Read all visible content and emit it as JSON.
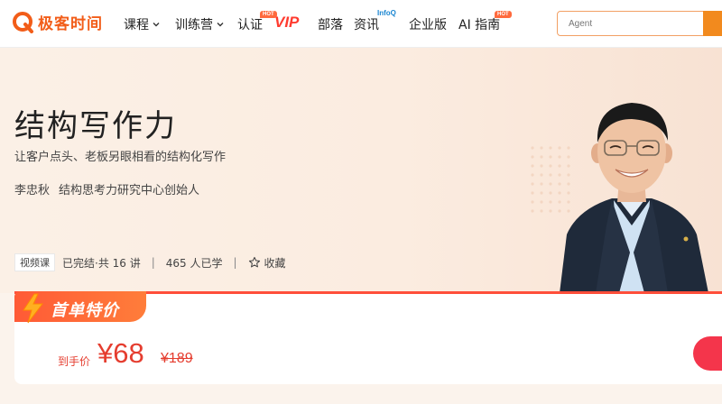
{
  "nav": {
    "logo_text": "极客时间",
    "items": [
      {
        "label": "课程",
        "has_dropdown": true
      },
      {
        "label": "训练营",
        "has_dropdown": true
      },
      {
        "label": "认证",
        "badge": "HOT"
      },
      {
        "label": "VIP"
      },
      {
        "label": "部落"
      },
      {
        "label": "资讯",
        "badge": "InfoQ"
      },
      {
        "label": "企业版"
      },
      {
        "label": "AI 指南",
        "badge": "HOT"
      }
    ],
    "search_placeholder": "Agent"
  },
  "course": {
    "title": "结构写作力",
    "subtitle": "让客户点头、老板另眼相看的结构化写作",
    "author": "李忠秋",
    "author_role": "结构思考力研究中心创始人",
    "type_tag": "视频课",
    "status": "已完结·共 16 讲",
    "learners": "465 人已学",
    "favorite_label": "收藏"
  },
  "price": {
    "badge": "首单特价",
    "label": "到手价",
    "current": "¥68",
    "original": "¥189"
  },
  "colors": {
    "brand": "#f25d19",
    "price": "#e53d2f",
    "badge": "#ff5a36",
    "buy": "#f4354b"
  }
}
